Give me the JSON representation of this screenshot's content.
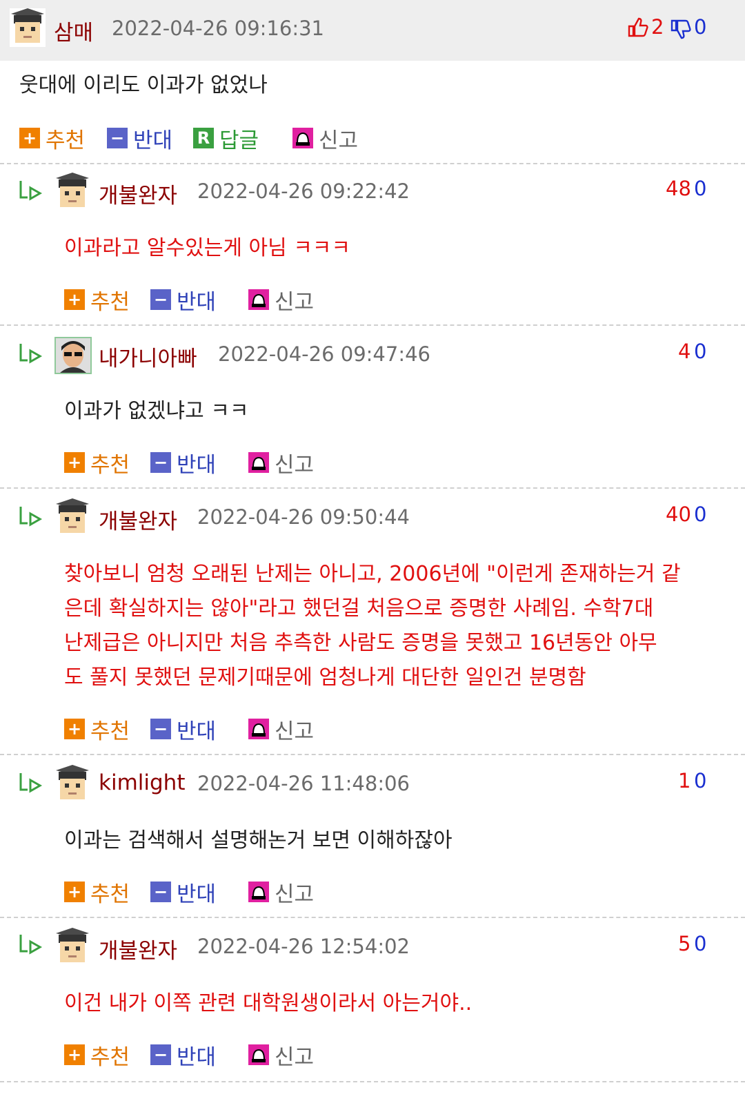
{
  "comments": [
    {
      "name": "삼매",
      "date": "2022-04-26 09:16:31",
      "up": "2",
      "down": "0",
      "text": "웃대에 이리도 이과가 없었나",
      "is_reply": false,
      "has_reply_button": true
    },
    {
      "name": "개불완자",
      "date": "2022-04-26 09:22:42",
      "up": "48",
      "down": "0",
      "text": "이과라고 알수있는게 아님 ㅋㅋㅋ",
      "is_reply": true
    },
    {
      "name": "내가니아빠",
      "date": "2022-04-26 09:47:46",
      "up": "4",
      "down": "0",
      "text": "이과가 없겠냐고 ㅋㅋ",
      "is_reply": true
    },
    {
      "name": "개불완자",
      "date": "2022-04-26 09:50:44",
      "up": "40",
      "down": "0",
      "lines": [
        "찾아보니 엄청 오래된 난제는 아니고, 2006년에 \"이런게 존재하는거 같",
        "은데 확실하지는 않아\"라고 했던걸 처음으로 증명한 사례임. 수학7대",
        "난제급은 아니지만 처음 추측한 사람도 증명을 못했고 16년동안 아무",
        "도 풀지 못했던 문제기때문에 엄청나게 대단한 일인건 분명함"
      ],
      "is_reply": true
    },
    {
      "name": "kimlight",
      "date": "2022-04-26 11:48:06",
      "up": "1",
      "down": "0",
      "text": "이과는 검색해서 설명해논거 보면 이해하잖아",
      "is_reply": true
    },
    {
      "name": "개불완자",
      "date": "2022-04-26 12:54:02",
      "up": "5",
      "down": "0",
      "text": "이건 내가 이쪽 관련 대학원생이라서 아는거야..",
      "is_reply": true
    }
  ],
  "actions": {
    "recommend": "추천",
    "oppose": "반대",
    "reply": "답글",
    "report": "신고"
  },
  "icons": {
    "plus": "+",
    "minus": "−",
    "reply_badge": "R"
  },
  "colors": {
    "red": "#e01010",
    "blue": "#1a2fd0",
    "orange": "#f08000"
  }
}
